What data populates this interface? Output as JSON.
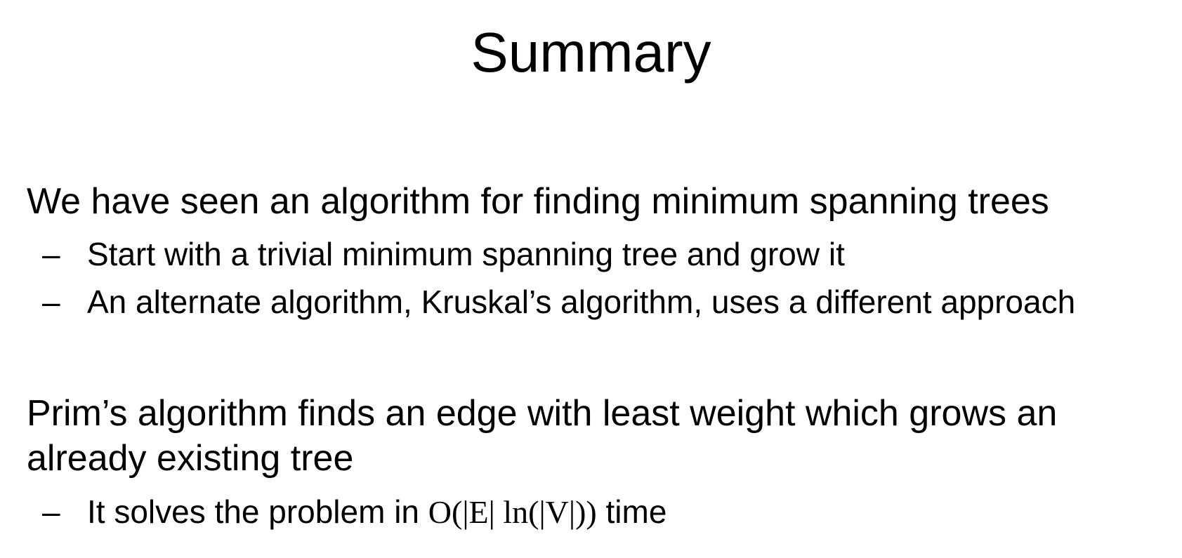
{
  "title": "Summary",
  "paragraphs": [
    {
      "text": "We have seen an algorithm for finding minimum spanning trees",
      "bullets": [
        "Start with a trivial minimum spanning tree and grow it",
        "An alternate algorithm, Kruskal’s algorithm, uses a different approach"
      ]
    },
    {
      "lines": [
        "Prim’s algorithm finds an edge with least weight which grows an",
        "already existing tree"
      ],
      "bullet": {
        "prefix": "It solves the problem in ",
        "formula": "O(|E| ln(|V|))",
        "suffix": " time"
      }
    }
  ],
  "bullet_marker": "–"
}
